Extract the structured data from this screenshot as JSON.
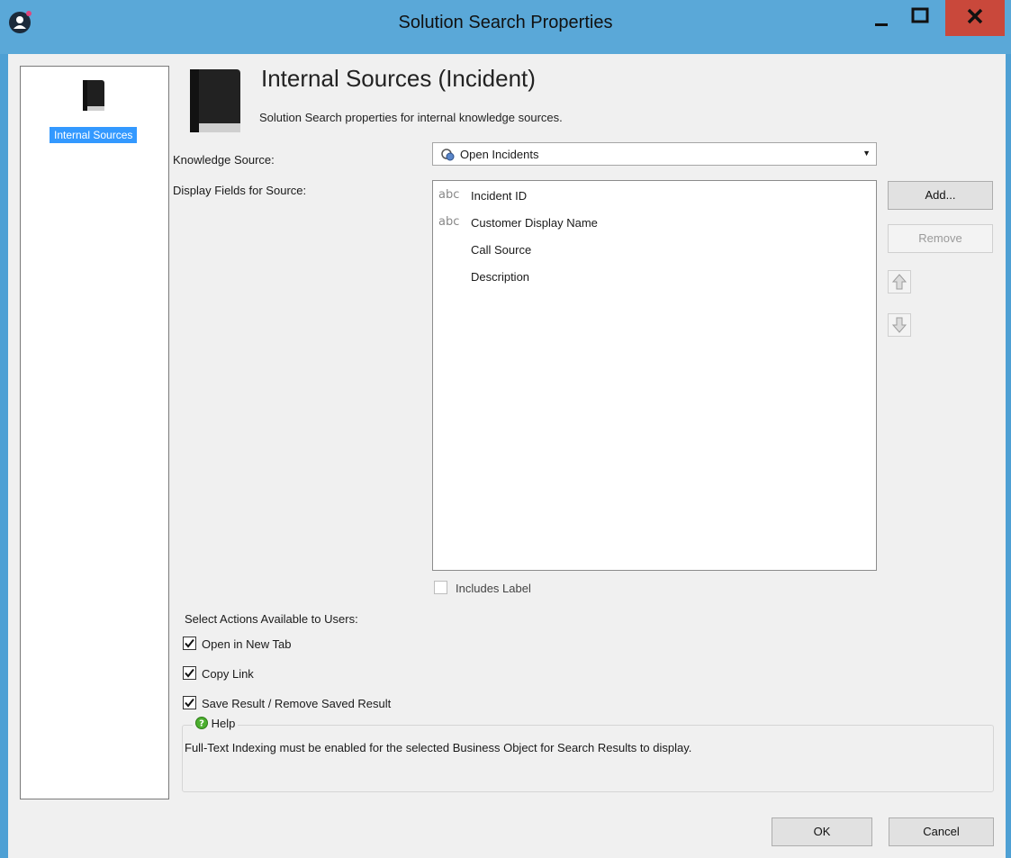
{
  "window": {
    "title": "Solution Search Properties"
  },
  "nav": {
    "items": [
      {
        "label": "Internal Sources"
      }
    ]
  },
  "header": {
    "title": "Internal Sources (Incident)",
    "subtitle": "Solution Search properties for internal knowledge sources."
  },
  "form": {
    "knowledge_source_label": "Knowledge Source:",
    "knowledge_source_value": "Open Incidents",
    "display_fields_label": "Display Fields for Source:",
    "fields": [
      {
        "icon": "abc",
        "label": "Incident ID"
      },
      {
        "icon": "abc",
        "label": "Customer Display Name"
      },
      {
        "icon": "",
        "label": "Call Source"
      },
      {
        "icon": "",
        "label": "Description"
      }
    ],
    "add_label": "Add...",
    "remove_label": "Remove",
    "includes_label": "Includes Label",
    "includes_label_checked": false
  },
  "actions": {
    "heading": "Select Actions Available to Users:",
    "items": [
      {
        "label": "Open in New Tab",
        "checked": true
      },
      {
        "label": "Copy Link",
        "checked": true
      },
      {
        "label": "Save Result / Remove Saved Result",
        "checked": true
      }
    ]
  },
  "help": {
    "title": "Help",
    "text": "Full-Text Indexing must be enabled for the selected Business Object for Search Results to display."
  },
  "footer": {
    "ok_label": "OK",
    "cancel_label": "Cancel"
  },
  "colors": {
    "titlebar": "#5aa8d8",
    "close": "#c9483b",
    "selection": "#3399ff"
  }
}
